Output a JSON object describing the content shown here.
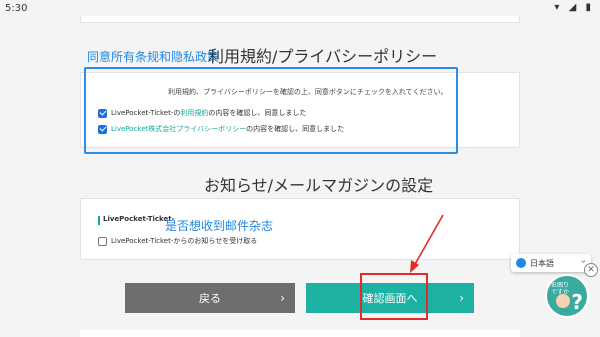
{
  "status_bar": {
    "time": "5:30",
    "icons": "▾ ◢ ▮"
  },
  "terms_section": {
    "title": "利用規約/プライバシーポリシー",
    "annotation": "同意所有条规和隐私政策",
    "instruction": "利用規約、プライバシーポリシーを確認の上、同意ボタンにチェックを入れてください。",
    "check1": {
      "prefix": "LivePocket-Ticket-の",
      "link": "利用規約",
      "suffix": "の内容を確認し、同意しました",
      "checked": true
    },
    "check2": {
      "prefix": "",
      "link": "LivePocket株式会社プライバシーポリシー",
      "suffix": "の内容を確認し、同意しました",
      "checked": true
    }
  },
  "newsletter_section": {
    "title": "お知らせ/メールマガジンの設定",
    "annotation": "是否想收到邮件杂志",
    "label": "LivePocket-Ticket-",
    "check": {
      "text": "LivePocket-Ticket-からのお知らせを受け取る",
      "checked": false
    }
  },
  "buttons": {
    "back": "戻る",
    "confirm": "確認画面へ",
    "chevron": "›"
  },
  "language": {
    "label": "日本語",
    "chevron": "›"
  },
  "help": {
    "close": "✕",
    "text": "お困り\nですか",
    "q": "?"
  },
  "colors": {
    "back_button": "#6e6e6e",
    "confirm_button": "#1db1a3",
    "accent_blue": "#2a8de8",
    "highlight_red": "#e02b2b"
  }
}
